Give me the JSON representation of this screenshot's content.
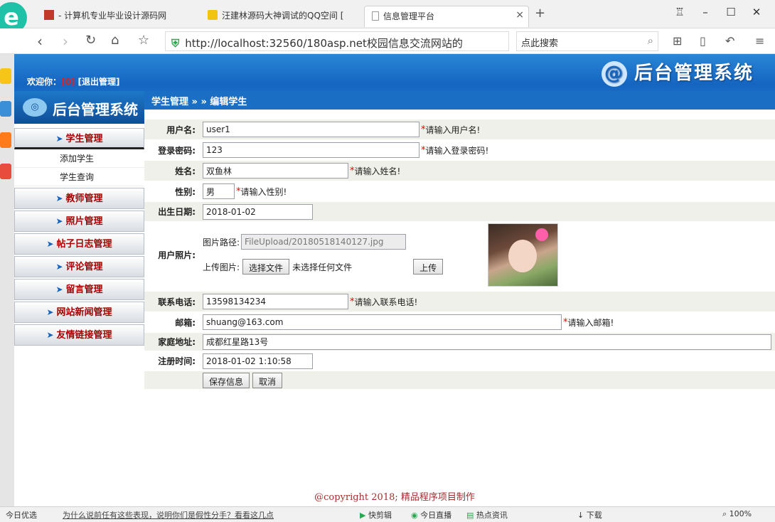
{
  "browser": {
    "tabs": [
      {
        "label": "- 计算机专业毕业设计源码网"
      },
      {
        "label": "汪建林源码大神调试的QQ空间 ["
      },
      {
        "label": "信息管理平台"
      }
    ],
    "url": "http://localhost:32560/180asp.net校园信息交流网站的",
    "search_placeholder": "点此搜索",
    "close_glyph": "×",
    "newtab_glyph": "+"
  },
  "header": {
    "welcome_label": "欢迎你：",
    "user": "[0]",
    "logout": "[退出管理]",
    "system_title": "后台管理系统"
  },
  "sidebar": {
    "title": "后台管理系统",
    "groups": [
      {
        "label": "学生管理"
      },
      {
        "label": "教师管理"
      },
      {
        "label": "照片管理"
      },
      {
        "label": "帖子日志管理"
      },
      {
        "label": "评论管理"
      },
      {
        "label": "留言管理"
      },
      {
        "label": "网站新闻管理"
      },
      {
        "label": "友情链接管理"
      }
    ],
    "subitems": [
      {
        "label": "添加学生"
      },
      {
        "label": "学生查询"
      }
    ]
  },
  "breadcrumb": "学生管理 » » 编辑学生",
  "form": {
    "username": {
      "label": "用户名:",
      "value": "user1",
      "hint": "请输入用户名!"
    },
    "password": {
      "label": "登录密码:",
      "value": "123",
      "hint": "请输入登录密码!"
    },
    "name": {
      "label": "姓名:",
      "value": "双鱼林",
      "hint": "请输入姓名!"
    },
    "gender": {
      "label": "性别:",
      "value": "男",
      "hint": "请输入性别!"
    },
    "birthday": {
      "label": "出生日期:",
      "value": "2018-01-02"
    },
    "photo": {
      "label": "用户照片:",
      "path_label": "图片路径:",
      "path_value": "FileUpload/20180518140127.jpg",
      "upload_label": "上传图片:",
      "choose_button": "选择文件",
      "no_file": "未选择任何文件",
      "upload_button": "上传"
    },
    "phone": {
      "label": "联系电话:",
      "value": "13598134234",
      "hint": "请输入联系电话!"
    },
    "email": {
      "label": "邮箱:",
      "value": "shuang@163.com",
      "hint": "请输入邮箱!"
    },
    "address": {
      "label": "家庭地址:",
      "value": "成都红星路13号"
    },
    "regtime": {
      "label": "注册时间:",
      "value": "2018-01-02 1:10:58"
    },
    "save_button": "保存信息",
    "cancel_button": "取消"
  },
  "footer": "@copyright 2018; 精品程序项目制作",
  "statusbar": {
    "items": [
      {
        "label": "今日优选"
      },
      {
        "label": "为什么说前任有这些表现，说明你们是假性分手？看看这几点"
      },
      {
        "label": "快剪辑"
      },
      {
        "label": "今日直播"
      },
      {
        "label": "热点资讯"
      },
      {
        "label": "下载"
      },
      {
        "label": "100%"
      }
    ]
  },
  "colors": {
    "header": "#1565c0",
    "accent_red": "#a00000",
    "hint_star": "#e00000"
  }
}
